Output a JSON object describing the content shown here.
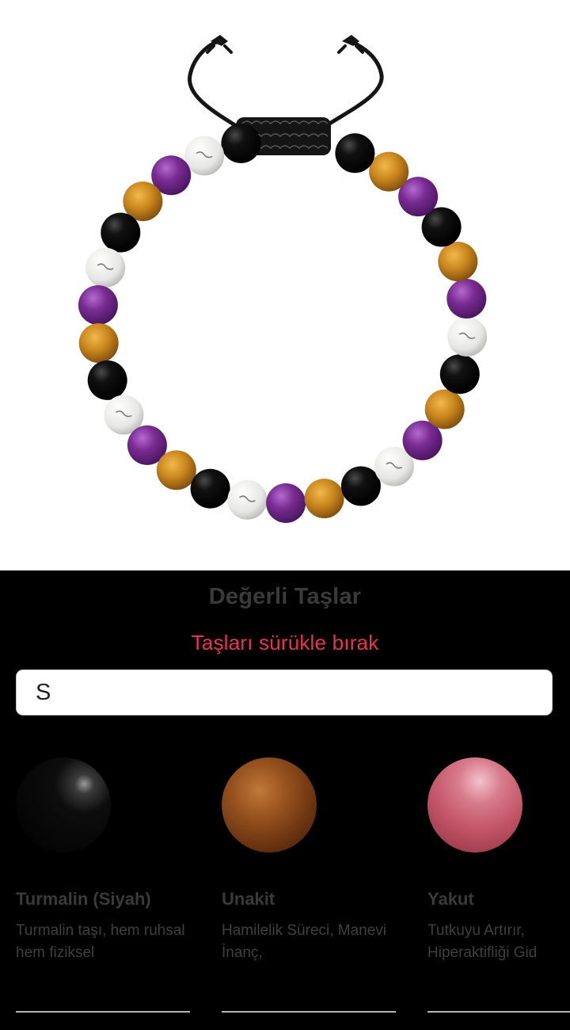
{
  "preview": {
    "cord_color": "#151515",
    "bead_order": [
      "black",
      "white",
      "purple",
      "tiger",
      "black",
      "white",
      "purple",
      "tiger",
      "black",
      "white",
      "purple",
      "tiger",
      "black",
      "white",
      "purple",
      "tiger",
      "black",
      "white",
      "purple",
      "tiger",
      "black",
      "white",
      "purple",
      "tiger",
      "black",
      "purple",
      "tiger",
      "black"
    ],
    "bead_colors": {
      "black": "#0b0b0b",
      "white": "#e9e9e7",
      "purple": "#7a2c93",
      "tiger": "#c9861d"
    }
  },
  "panel": {
    "title": "Değerli Taşlar",
    "subtitle": "Taşları sürükle bırak",
    "accent_color": "#e8344f"
  },
  "search": {
    "value": "S",
    "placeholder": ""
  },
  "stones": [
    {
      "name": "Turmalin (Siyah)",
      "description": "Turmalin taşı, hem ruhsal hem fiziksel",
      "color": "#0d0d0d"
    },
    {
      "name": "Unakit",
      "description": "Hamilelik Süreci, Manevi İnanç,",
      "color": "#7a4416"
    },
    {
      "name": "Yakut",
      "description": "Tutkuyu Artırır, Hiperaktifliği Gid",
      "color": "#c25567"
    }
  ]
}
